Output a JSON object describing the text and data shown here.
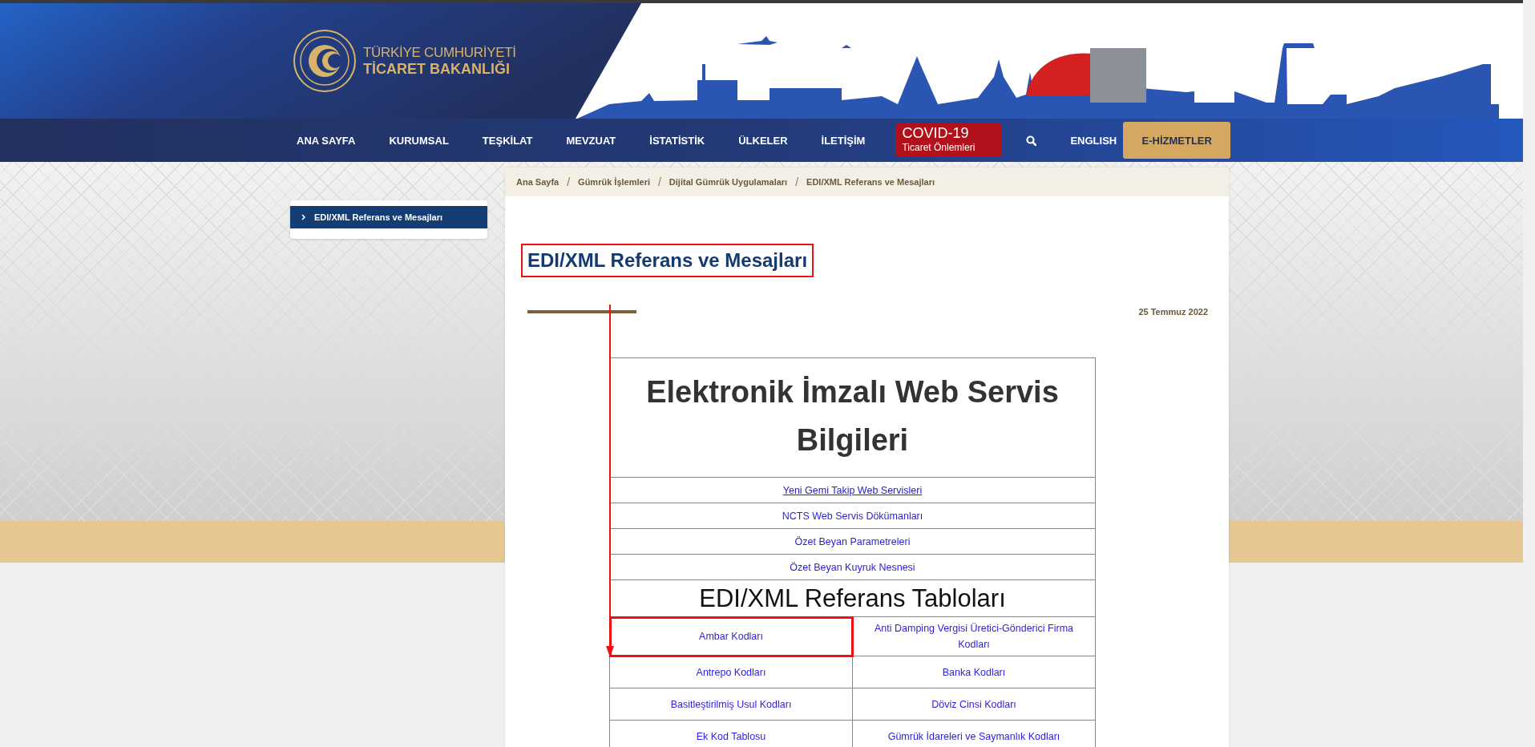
{
  "header": {
    "logo": {
      "line1": "TÜRKİYE CUMHURİYETİ",
      "line2": "TİCARET BAKANLIĞI"
    },
    "nav": [
      {
        "kind": "link",
        "label": "ANA SAYFA"
      },
      {
        "kind": "link",
        "label": "KURUMSAL"
      },
      {
        "kind": "link",
        "label": "TEŞKİLAT"
      },
      {
        "kind": "link",
        "label": "MEVZUAT"
      },
      {
        "kind": "link",
        "label": "İSTATİSTİK"
      },
      {
        "kind": "link",
        "label": "ÜLKELER"
      },
      {
        "kind": "link",
        "label": "İLETİŞİM"
      },
      {
        "kind": "covid",
        "line1": "COVID-19",
        "line2": "Ticaret Önlemleri"
      },
      {
        "kind": "search"
      },
      {
        "kind": "link",
        "label": "ENGLISH"
      },
      {
        "kind": "button",
        "label": "E-HİZMETLER"
      }
    ]
  },
  "sidebar": {
    "items": [
      {
        "label": "EDI/XML Referans ve Mesajları",
        "selected": true
      }
    ]
  },
  "breadcrumb": {
    "separator": "/",
    "items": [
      "Ana Sayfa",
      "Gümrük İşlemleri",
      "Dijital Gümrük Uygulamaları",
      "EDI/XML Referans ve Mesajları"
    ]
  },
  "page": {
    "title": "EDI/XML Referans ve Mesajları",
    "title_highlighted": true,
    "date": "25 Temmuz 2022"
  },
  "table": {
    "rows": [
      {
        "kind": "heading",
        "text": "Elektronik İmzalı Web Servis Bilgileri"
      },
      {
        "kind": "link",
        "text": "Yeni Gemi Takip Web Servisleri",
        "underlined": true
      },
      {
        "kind": "link",
        "text": "NCTS Web Servis Dökümanları",
        "underlined": false
      },
      {
        "kind": "link",
        "text": "Özet Beyan Parametreleri",
        "underlined": false
      },
      {
        "kind": "link",
        "text": "Özet Beyan Kuyruk Nesnesi",
        "underlined": false
      },
      {
        "kind": "subheading",
        "text": "EDI/XML Referans Tabloları"
      },
      {
        "kind": "pair",
        "cells": [
          {
            "text": "Ambar Kodları",
            "highlighted": true
          },
          {
            "text": "Anti Damping Vergisi Üretici-Gönderici Firma Kodları",
            "highlighted": false
          }
        ]
      },
      {
        "kind": "pair",
        "cells": [
          {
            "text": "Antrepo Kodları",
            "highlighted": false
          },
          {
            "text": "Banka Kodları",
            "highlighted": false
          }
        ]
      },
      {
        "kind": "pair",
        "cells": [
          {
            "text": "Basitleştirilmiş Usul Kodları",
            "highlighted": false
          },
          {
            "text": "Döviz Cinsi Kodları",
            "highlighted": false
          }
        ]
      },
      {
        "kind": "pair",
        "cells": [
          {
            "text": "Ek Kod Tablosu",
            "highlighted": false
          },
          {
            "text": "Gümrük İdareleri ve Saymanlık Kodları",
            "highlighted": false
          }
        ]
      }
    ]
  },
  "annotation_arrow": true
}
